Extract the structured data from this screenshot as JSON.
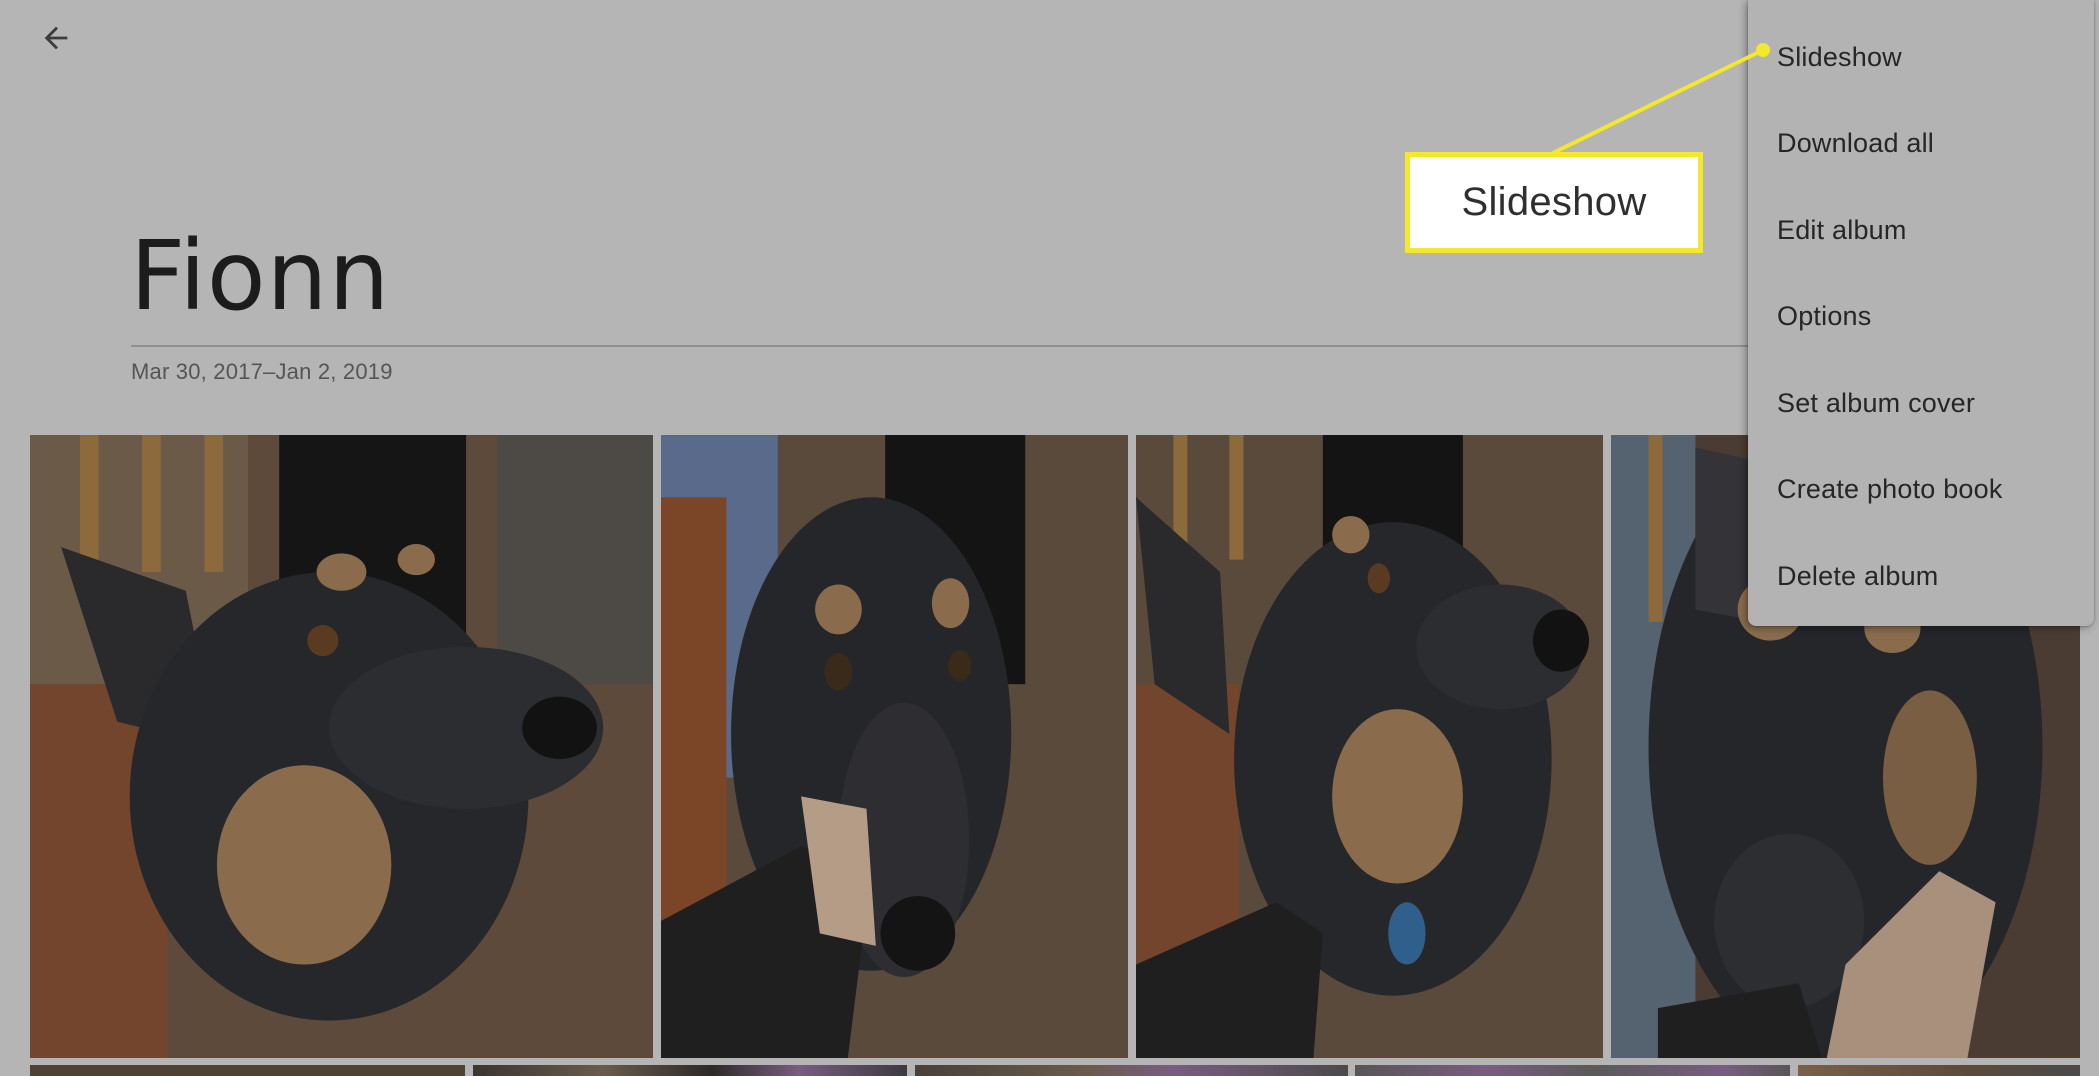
{
  "header": {
    "back_icon": "arrow-left-icon"
  },
  "album": {
    "title": "Fionn",
    "date_range": "Mar 30, 2017–Jan 2, 2019"
  },
  "photos_row1": [
    {
      "subject": "dog-portrait-looking-right"
    },
    {
      "subject": "dog-face-held-by-hand"
    },
    {
      "subject": "dog-looking-right-with-tag"
    },
    {
      "subject": "dog-nose-closeup"
    }
  ],
  "photos_row2_count_visible": 5,
  "menu": {
    "items": [
      {
        "label": "Slideshow"
      },
      {
        "label": "Download all"
      },
      {
        "label": "Edit album"
      },
      {
        "label": "Options"
      },
      {
        "label": "Set album cover"
      },
      {
        "label": "Create photo book"
      },
      {
        "label": "Delete album"
      }
    ]
  },
  "annotation": {
    "label": "Slideshow",
    "color": "#f5e72a"
  }
}
